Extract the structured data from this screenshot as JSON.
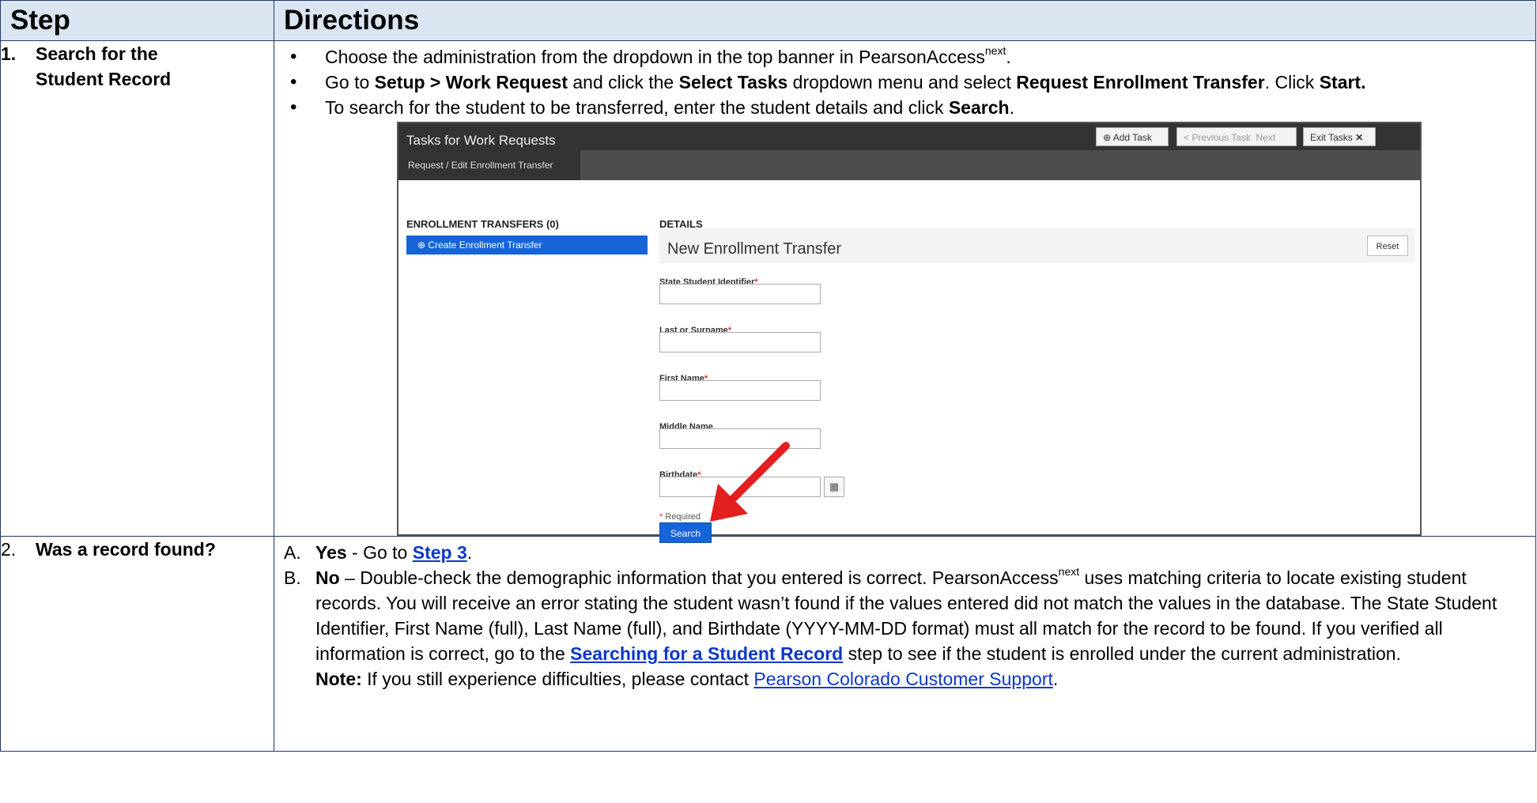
{
  "header": {
    "step": "Step",
    "directions": "Directions"
  },
  "row1": {
    "step_num": "1.",
    "step_line1": "Search for the",
    "step_line2": "Student Record",
    "bullet1": {
      "text": "Choose the administration from the dropdown in the top banner in PearsonAccess",
      "sup": "next",
      "end": "."
    },
    "bullet2": {
      "t1": "Go to ",
      "b1": "Setup > Work Request",
      "t2": " and click the ",
      "b2": "Select Tasks",
      "t3": " dropdown menu and select ",
      "b3": "Request Enrollment Transfer",
      "t4": ". Click ",
      "b4": "Start."
    },
    "bullet3": {
      "t1": "To search for the student to be transferred, enter the student details and click ",
      "b1": "Search",
      "end": "."
    }
  },
  "screenshot": {
    "window_title": "Tasks for Work Requests",
    "add_task": "Add Task",
    "prev_task": "Previous Task",
    "next_task": "Next Task",
    "exit_tasks": "Exit Tasks",
    "tab": "Request / Edit Enrollment Transfer",
    "left_title": "ENROLLMENT TRANSFERS (0)",
    "create_btn": "Create Enrollment Transfer",
    "details_title": "DETAILS",
    "panel_title": "New Enrollment Transfer",
    "reset": "Reset",
    "fields": {
      "ssid": "State Student Identifier",
      "last": "Last or Surname",
      "first": "First Name",
      "middle": "Middle Name",
      "birth": "Birthdate"
    },
    "required_mark": "*",
    "required_note": " Required",
    "search": "Search"
  },
  "row2": {
    "step_num": "2.",
    "step_text": "Was a record found?",
    "a_letter": "A.",
    "a_bold": "Yes",
    "a_text": " - Go to ",
    "a_link": "Step 3",
    "a_end": ".",
    "b_letter": "B.",
    "b_bold": "No",
    "b_t1": " – Double-check the demographic information that you entered is correct. PearsonAccess",
    "b_sup": "next",
    "b_t2": " uses matching criteria to locate existing student records. You will receive an error stating the student wasn’t found if the values entered did not match the values in the database. The State Student Identifier, First Name (full), Last Name (full), and Birthdate (YYYY-MM-DD format) must all match for the record to be found. If you verified all information is correct, go to the ",
    "b_link": "Searching for a Student Record",
    "b_t3": " step to see if the student is enrolled under the current administration.",
    "note_bold": "Note:",
    "note_text": " If you still experience difficulties, please contact ",
    "note_link": "Pearson Colorado Customer Support",
    "note_end": "."
  }
}
